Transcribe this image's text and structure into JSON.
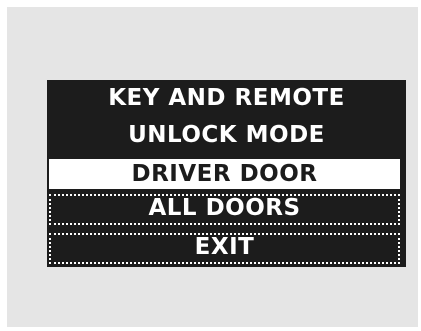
{
  "screen": {
    "title_line1": "KEY AND REMOTE",
    "title_line2": "UNLOCK MODE"
  },
  "menu": {
    "options": [
      {
        "label": "DRIVER DOOR",
        "selected": true
      },
      {
        "label": "ALL DOORS",
        "selected": false
      },
      {
        "label": "EXIT",
        "selected": false
      }
    ]
  },
  "colors": {
    "screen_background": "#1c1c1c",
    "text": "#ffffff",
    "panel_background": "#e5e5e5"
  }
}
